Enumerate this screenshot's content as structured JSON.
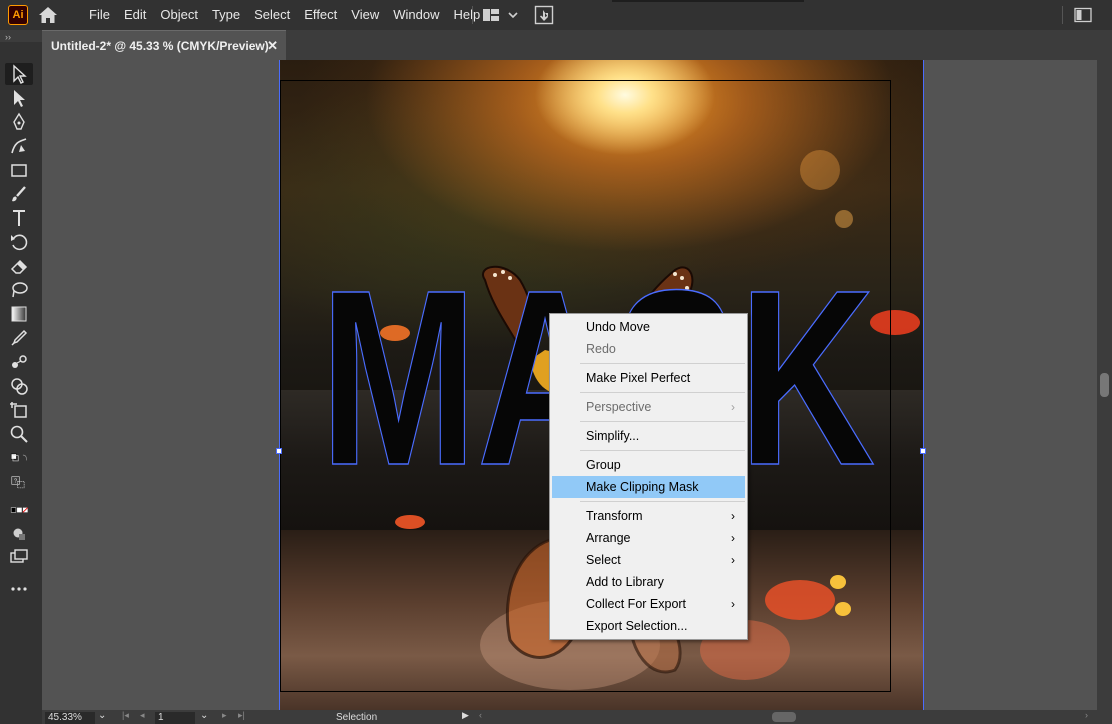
{
  "app": {
    "logo_text": "Ai"
  },
  "menu": {
    "items": [
      "File",
      "Edit",
      "Object",
      "Type",
      "Select",
      "Effect",
      "View",
      "Window",
      "Help"
    ]
  },
  "tab": {
    "collapse": "››",
    "title": "Untitled-2* @ 45.33 % (CMYK/Preview)",
    "close": "✕"
  },
  "canvas": {
    "mask_text": "MASK"
  },
  "context_menu": {
    "items": [
      {
        "label": "Undo Move",
        "disabled": false,
        "submenu": false
      },
      {
        "label": "Redo",
        "disabled": true,
        "submenu": false
      },
      {
        "separator": true
      },
      {
        "label": "Make Pixel Perfect",
        "disabled": false,
        "submenu": false
      },
      {
        "separator": true
      },
      {
        "label": "Perspective",
        "disabled": true,
        "submenu": true
      },
      {
        "separator": true
      },
      {
        "label": "Simplify...",
        "disabled": false,
        "submenu": false
      },
      {
        "separator": true
      },
      {
        "label": "Group",
        "disabled": false,
        "submenu": false
      },
      {
        "label": "Make Clipping Mask",
        "disabled": false,
        "submenu": false,
        "highlighted": true
      },
      {
        "separator": true
      },
      {
        "label": "Transform",
        "disabled": false,
        "submenu": true
      },
      {
        "label": "Arrange",
        "disabled": false,
        "submenu": true
      },
      {
        "label": "Select",
        "disabled": false,
        "submenu": true
      },
      {
        "label": "Add to Library",
        "disabled": false,
        "submenu": false
      },
      {
        "label": "Collect For Export",
        "disabled": false,
        "submenu": true
      },
      {
        "label": "Export Selection...",
        "disabled": false,
        "submenu": false
      }
    ]
  },
  "status": {
    "zoom": "45.33%",
    "page": "1",
    "tool_name": "Selection"
  },
  "colors": {
    "accent_selection": "#4a6cff",
    "menu_highlight": "#91c9f7",
    "ui_dark": "#323232",
    "canvas_bg": "#535353"
  }
}
